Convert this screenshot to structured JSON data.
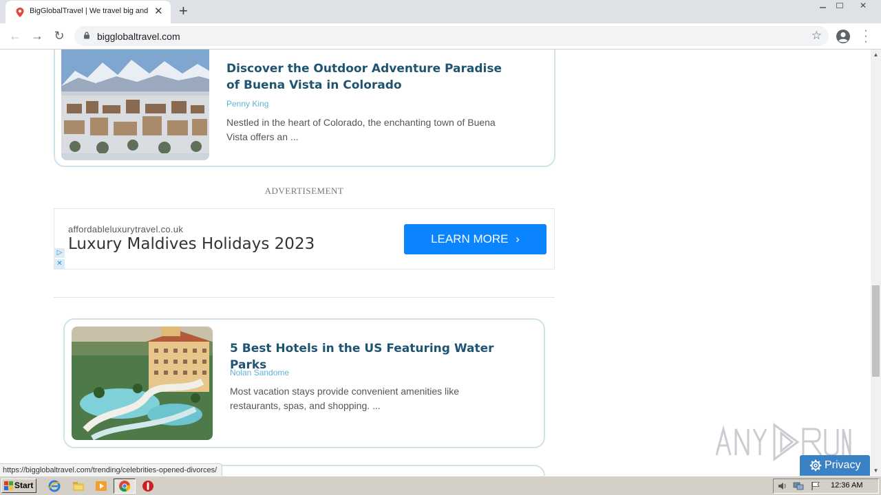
{
  "browser": {
    "tab": {
      "title": "BigGlobalTravel | We travel big and compare"
    },
    "new_tab_symbol": "+",
    "address": {
      "url": "bigglobaltravel.com"
    }
  },
  "page": {
    "cards": [
      {
        "title": "Discover the Outdoor Adventure Paradise of Buena Vista in Colorado",
        "author": "Penny King",
        "excerpt": "Nestled in the heart of Colorado, the enchanting town of Buena Vista offers an ..."
      },
      {
        "title": "5 Best Hotels in the US Featuring Water Parks",
        "author": "Nolan Sandome",
        "excerpt": "Most vacation stays provide convenient amenities like restaurants, spas, and shopping. ..."
      }
    ],
    "advertisement": {
      "label": "ADVERTISEMENT",
      "domain": "affordableluxurytravel.co.uk",
      "headline": "Luxury Maldives Holidays 2023",
      "cta": "LEARN MORE"
    },
    "status_url": "https://bigglobaltravel.com/trending/celebrities-opened-divorces/",
    "privacy_button": "Privacy",
    "watermark": "ANY RUN"
  },
  "taskbar": {
    "start_label": "Start",
    "clock": "12:36 AM"
  },
  "colors": {
    "card_title": "#1f5471",
    "author": "#5bb4d6",
    "cta_bg": "#0a84ff",
    "privacy_bg": "#3b82c4"
  }
}
